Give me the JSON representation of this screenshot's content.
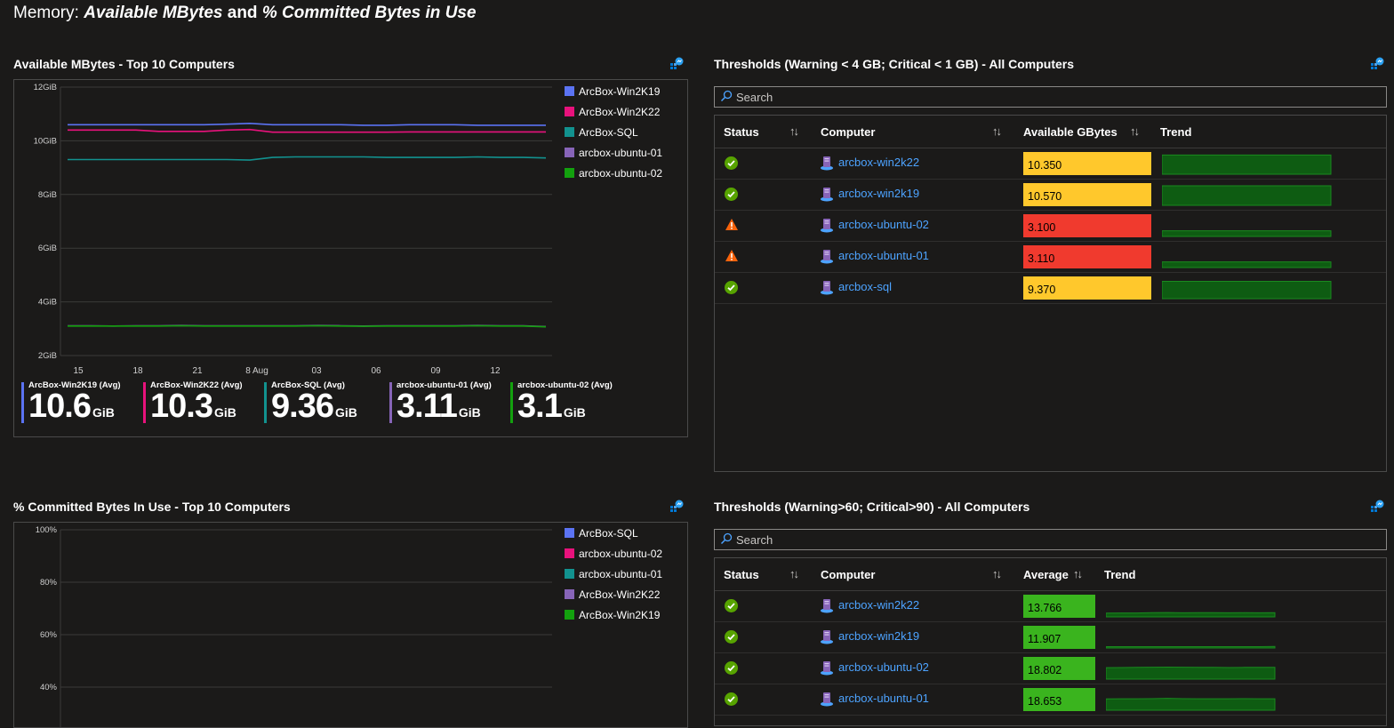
{
  "page_title": {
    "prefix": "Memory: ",
    "part1": "Available MBytes",
    "mid": " and ",
    "part2": "% Committed Bytes in Use"
  },
  "tiles": {
    "avail_chart": {
      "title": "Available MBytes - Top 10 Computers"
    },
    "avail_grid": {
      "title": "Thresholds (Warning < 4 GB; Critical < 1 GB) - All Computers"
    },
    "committed_chart": {
      "title": "% Committed Bytes In Use - Top 10 Computers"
    },
    "committed_grid": {
      "title": "Thresholds (Warning>60; Critical>90) - All Computers"
    }
  },
  "colors": {
    "blue": "#5b73f3",
    "magenta": "#e8127c",
    "teal": "#12928f",
    "purple": "#8764b8",
    "green": "#13a10e",
    "warning": "#ffc82c",
    "critical": "#f03a2e",
    "ok": "#3ab41e",
    "link": "#4da3ff"
  },
  "avail_legend": [
    {
      "name": "ArcBox-Win2K19",
      "color": "#5b73f3"
    },
    {
      "name": "ArcBox-Win2K22",
      "color": "#e8127c"
    },
    {
      "name": "ArcBox-SQL",
      "color": "#12928f"
    },
    {
      "name": "arcbox-ubuntu-01",
      "color": "#8764b8"
    },
    {
      "name": "arcbox-ubuntu-02",
      "color": "#13a10e"
    }
  ],
  "avail_kpis": [
    {
      "label": "ArcBox-Win2K19 (Avg)",
      "value": "10.6",
      "unit": "GiB",
      "color": "#5b73f3"
    },
    {
      "label": "ArcBox-Win2K22 (Avg)",
      "value": "10.3",
      "unit": "GiB",
      "color": "#e8127c"
    },
    {
      "label": "ArcBox-SQL (Avg)",
      "value": "9.36",
      "unit": "GiB",
      "color": "#12928f"
    },
    {
      "label": "arcbox-ubuntu-01 (Avg)",
      "value": "3.11",
      "unit": "GiB",
      "color": "#8764b8"
    },
    {
      "label": "arcbox-ubuntu-02 (Avg)",
      "value": "3.1",
      "unit": "GiB",
      "color": "#13a10e"
    }
  ],
  "committed_legend": [
    {
      "name": "ArcBox-SQL",
      "color": "#5b73f3"
    },
    {
      "name": "arcbox-ubuntu-02",
      "color": "#e8127c"
    },
    {
      "name": "arcbox-ubuntu-01",
      "color": "#12928f"
    },
    {
      "name": "ArcBox-Win2K22",
      "color": "#8764b8"
    },
    {
      "name": "ArcBox-Win2K19",
      "color": "#13a10e"
    }
  ],
  "chart_data": [
    {
      "type": "line",
      "title": "Available MBytes - Top 10 Computers",
      "y_ticks": [
        "12GiB",
        "10GiB",
        "8GiB",
        "6GiB",
        "4GiB",
        "2GiB"
      ],
      "ylim": [
        2,
        12
      ],
      "x_ticks": [
        "15",
        "18",
        "21",
        "8 Aug",
        "03",
        "06",
        "09",
        "12"
      ],
      "series": [
        {
          "name": "ArcBox-Win2K19",
          "color": "#5b73f3",
          "values": [
            10.6,
            10.6,
            10.6,
            10.6,
            10.6,
            10.6,
            10.6,
            10.62,
            10.65,
            10.6,
            10.6,
            10.6,
            10.6,
            10.58,
            10.58,
            10.6,
            10.6,
            10.6,
            10.58,
            10.58,
            10.58,
            10.58
          ]
        },
        {
          "name": "ArcBox-Win2K22",
          "color": "#e8127c",
          "values": [
            10.4,
            10.4,
            10.4,
            10.4,
            10.35,
            10.35,
            10.35,
            10.4,
            10.42,
            10.32,
            10.32,
            10.32,
            10.32,
            10.32,
            10.32,
            10.33,
            10.33,
            10.33,
            10.33,
            10.33,
            10.33,
            10.33
          ]
        },
        {
          "name": "ArcBox-SQL",
          "color": "#12928f",
          "values": [
            9.3,
            9.3,
            9.3,
            9.3,
            9.3,
            9.3,
            9.3,
            9.3,
            9.28,
            9.38,
            9.4,
            9.4,
            9.4,
            9.4,
            9.38,
            9.38,
            9.38,
            9.38,
            9.4,
            9.38,
            9.38,
            9.36
          ]
        },
        {
          "name": "arcbox-ubuntu-01",
          "color": "#8764b8",
          "values": [
            3.11,
            3.11,
            3.1,
            3.11,
            3.11,
            3.12,
            3.11,
            3.11,
            3.11,
            3.11,
            3.11,
            3.12,
            3.11,
            3.1,
            3.11,
            3.11,
            3.11,
            3.11,
            3.12,
            3.11,
            3.11,
            3.08
          ]
        },
        {
          "name": "arcbox-ubuntu-02",
          "color": "#13a10e",
          "values": [
            3.1,
            3.1,
            3.1,
            3.1,
            3.1,
            3.11,
            3.1,
            3.1,
            3.1,
            3.1,
            3.1,
            3.11,
            3.1,
            3.09,
            3.1,
            3.1,
            3.1,
            3.1,
            3.11,
            3.1,
            3.1,
            3.07
          ]
        }
      ]
    },
    {
      "type": "line",
      "title": "% Committed Bytes In Use - Top 10 Computers",
      "y_ticks": [
        "100%",
        "80%",
        "60%",
        "40%"
      ],
      "series": []
    }
  ],
  "avail_grid": {
    "search_placeholder": "Search",
    "headers": {
      "status": "Status",
      "computer": "Computer",
      "value": "Available GBytes",
      "trend": "Trend"
    },
    "rows": [
      {
        "status": "ok",
        "computer": "arcbox-win2k22",
        "value": "10.350",
        "level": "warning",
        "trend": [
          10.4,
          10.4,
          10.4,
          10.4,
          10.4,
          10.4,
          10.4,
          10.4
        ]
      },
      {
        "status": "ok",
        "computer": "arcbox-win2k19",
        "value": "10.570",
        "level": "warning",
        "trend": [
          10.6,
          10.6,
          10.6,
          10.6,
          10.6,
          10.6,
          10.6,
          10.6
        ]
      },
      {
        "status": "warn",
        "computer": "arcbox-ubuntu-02",
        "value": "3.100",
        "level": "critical",
        "trend": [
          3.1,
          3.1,
          3.1,
          3.1,
          3.1,
          3.1,
          3.1,
          3.1
        ]
      },
      {
        "status": "warn",
        "computer": "arcbox-ubuntu-01",
        "value": "3.110",
        "level": "critical",
        "trend": [
          3.1,
          3.1,
          3.1,
          3.1,
          3.1,
          3.1,
          3.1,
          3.1
        ]
      },
      {
        "status": "ok",
        "computer": "arcbox-sql",
        "value": "9.370",
        "level": "warning",
        "trend": [
          9.4,
          9.4,
          9.4,
          9.4,
          9.4,
          9.4,
          9.4,
          9.4
        ]
      }
    ]
  },
  "committed_grid": {
    "search_placeholder": "Search",
    "headers": {
      "status": "Status",
      "computer": "Computer",
      "value": "Average",
      "trend": "Trend"
    },
    "rows": [
      {
        "status": "ok",
        "computer": "arcbox-win2k22",
        "value": "13.766",
        "level": "ok",
        "trend": [
          13.5,
          13.6,
          13.6,
          13.8,
          13.9,
          13.7,
          13.8,
          13.8,
          13.7,
          13.8,
          13.7,
          13.8
        ]
      },
      {
        "status": "ok",
        "computer": "arcbox-win2k19",
        "value": "11.907",
        "level": "ok",
        "trend": [
          11.9,
          11.9,
          11.9,
          11.9,
          11.9,
          11.9,
          11.9,
          11.9,
          11.9,
          11.9,
          11.9,
          12.0
        ]
      },
      {
        "status": "ok",
        "computer": "arcbox-ubuntu-02",
        "value": "18.802",
        "level": "ok",
        "trend": [
          18.6,
          18.7,
          18.8,
          18.9,
          19.0,
          18.9,
          18.8,
          18.8,
          18.7,
          18.8,
          18.8,
          18.8
        ]
      },
      {
        "status": "ok",
        "computer": "arcbox-ubuntu-01",
        "value": "18.653",
        "level": "ok",
        "trend": [
          18.5,
          18.6,
          18.6,
          18.7,
          18.9,
          18.7,
          18.6,
          18.6,
          18.6,
          18.7,
          18.6,
          18.6
        ]
      }
    ]
  }
}
